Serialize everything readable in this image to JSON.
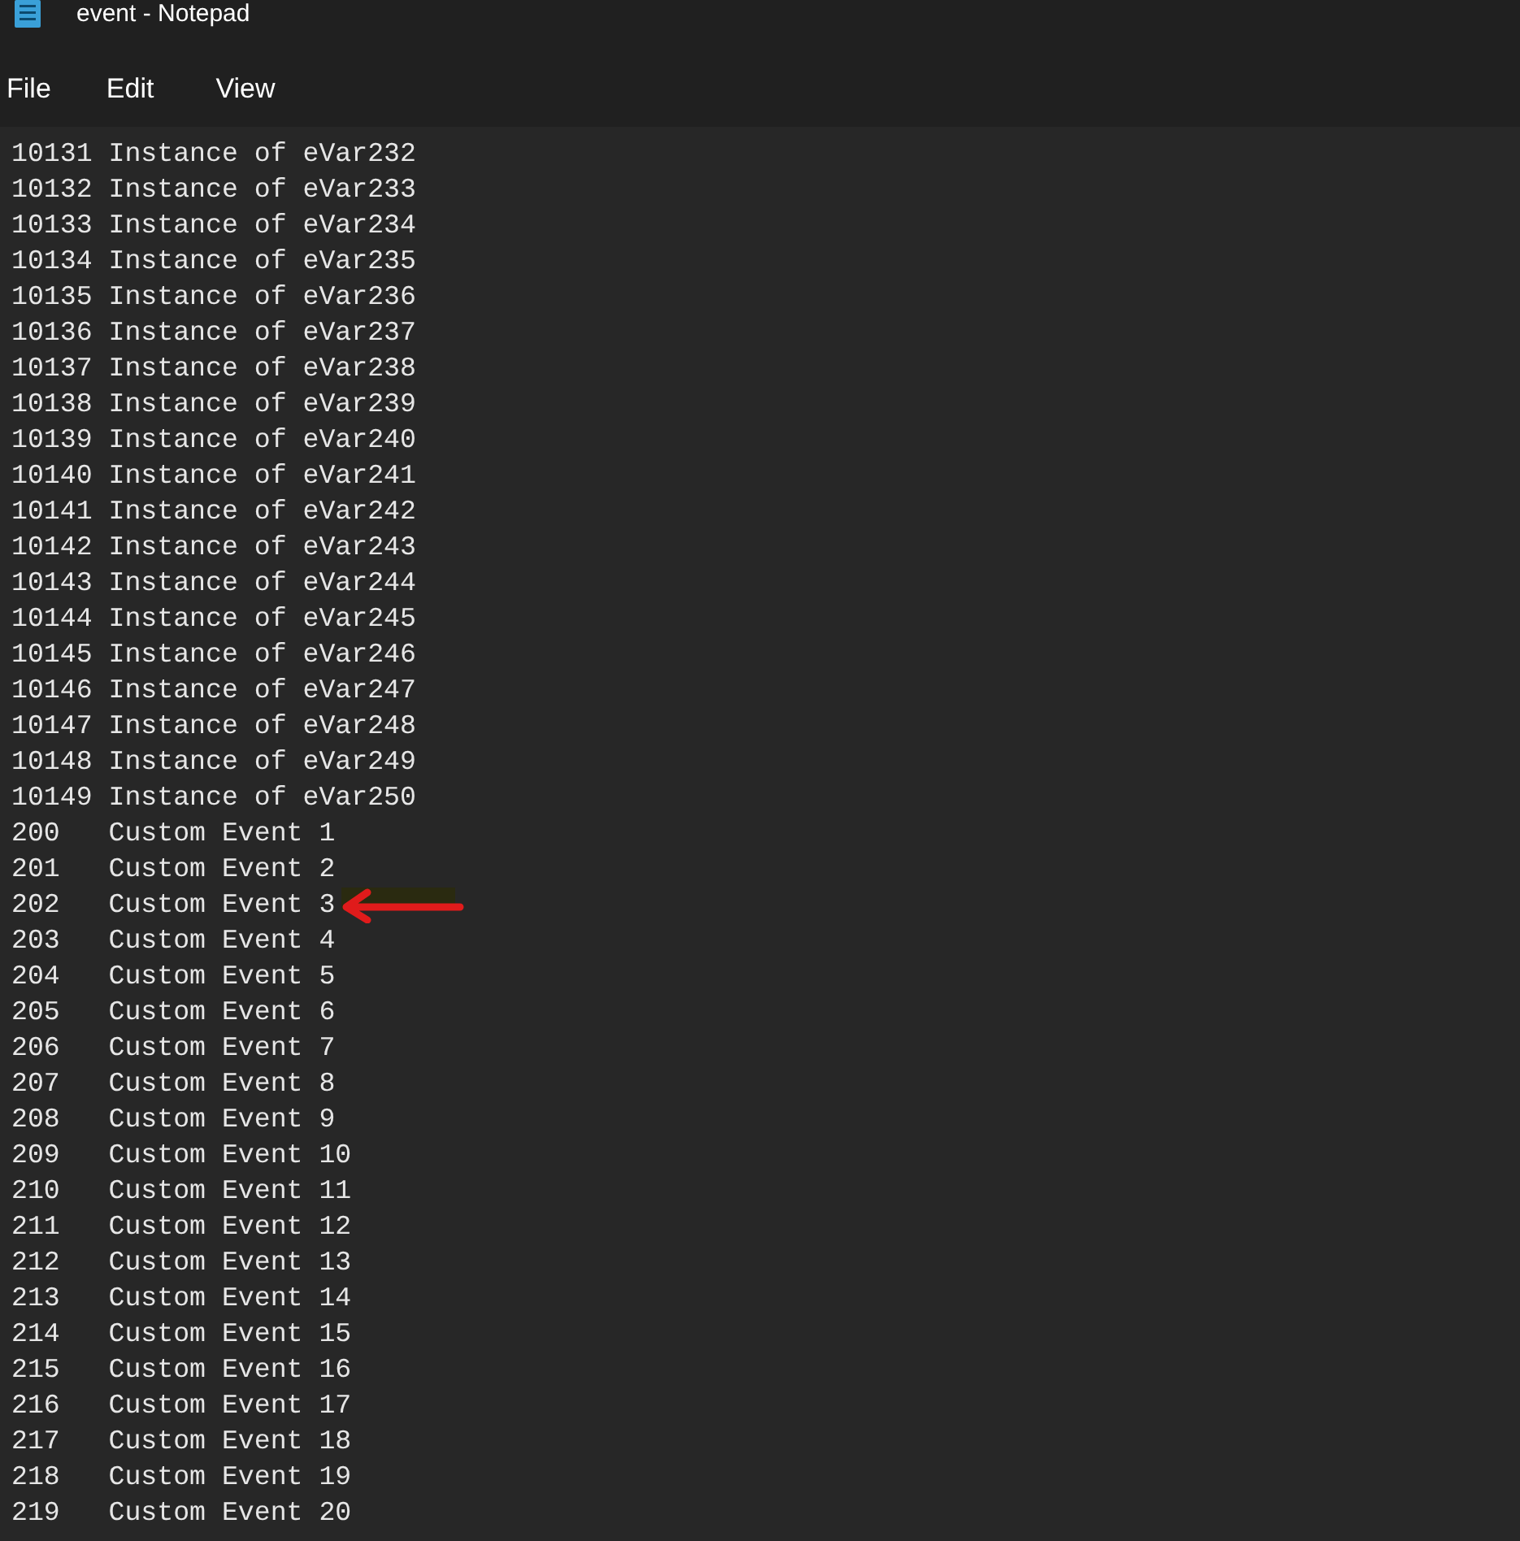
{
  "window": {
    "title": "event - Notepad"
  },
  "menu": [
    "File",
    "Edit",
    "View"
  ],
  "lines": [
    {
      "text": "10131 Instance of eVar232",
      "marked": false
    },
    {
      "text": "10132 Instance of eVar233",
      "marked": false
    },
    {
      "text": "10133 Instance of eVar234",
      "marked": false
    },
    {
      "text": "10134 Instance of eVar235",
      "marked": false
    },
    {
      "text": "10135 Instance of eVar236",
      "marked": false
    },
    {
      "text": "10136 Instance of eVar237",
      "marked": false
    },
    {
      "text": "10137 Instance of eVar238",
      "marked": false
    },
    {
      "text": "10138 Instance of eVar239",
      "marked": false
    },
    {
      "text": "10139 Instance of eVar240",
      "marked": false
    },
    {
      "text": "10140 Instance of eVar241",
      "marked": false
    },
    {
      "text": "10141 Instance of eVar242",
      "marked": false
    },
    {
      "text": "10142 Instance of eVar243",
      "marked": false
    },
    {
      "text": "10143 Instance of eVar244",
      "marked": false
    },
    {
      "text": "10144 Instance of eVar245",
      "marked": false
    },
    {
      "text": "10145 Instance of eVar246",
      "marked": false
    },
    {
      "text": "10146 Instance of eVar247",
      "marked": false
    },
    {
      "text": "10147 Instance of eVar248",
      "marked": false
    },
    {
      "text": "10148 Instance of eVar249",
      "marked": false
    },
    {
      "text": "10149 Instance of eVar250",
      "marked": false
    },
    {
      "text": "200\tCustom Event 1",
      "marked": false
    },
    {
      "text": "201\tCustom Event 2",
      "marked": false
    },
    {
      "text": "202\tCustom Event 3",
      "marked": true
    },
    {
      "text": "203\tCustom Event 4",
      "marked": false
    },
    {
      "text": "204\tCustom Event 5",
      "marked": false
    },
    {
      "text": "205\tCustom Event 6",
      "marked": false
    },
    {
      "text": "206\tCustom Event 7",
      "marked": false
    },
    {
      "text": "207\tCustom Event 8",
      "marked": false
    },
    {
      "text": "208\tCustom Event 9",
      "marked": false
    },
    {
      "text": "209\tCustom Event 10",
      "marked": false
    },
    {
      "text": "210\tCustom Event 11",
      "marked": false
    },
    {
      "text": "211\tCustom Event 12",
      "marked": false
    },
    {
      "text": "212\tCustom Event 13",
      "marked": false
    },
    {
      "text": "213\tCustom Event 14",
      "marked": false
    },
    {
      "text": "214\tCustom Event 15",
      "marked": false
    },
    {
      "text": "215\tCustom Event 16",
      "marked": false
    },
    {
      "text": "216\tCustom Event 17",
      "marked": false
    },
    {
      "text": "217\tCustom Event 18",
      "marked": false
    },
    {
      "text": "218\tCustom Event 19",
      "marked": false
    },
    {
      "text": "219\tCustom Event 20",
      "marked": false
    }
  ]
}
